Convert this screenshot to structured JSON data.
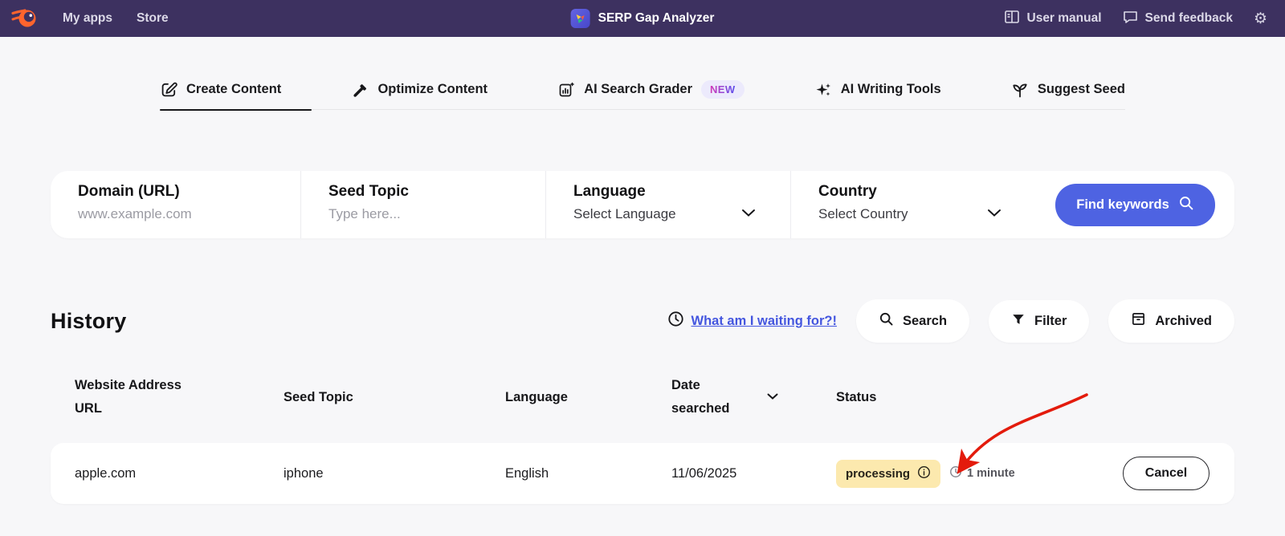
{
  "nav": {
    "logo_icon": "semrush-flame-icon",
    "items": [
      {
        "label": "My apps"
      },
      {
        "label": "Store"
      }
    ],
    "app_icon": "serp-gap-analyzer-app-icon",
    "app_title": "SERP Gap Analyzer",
    "links": [
      {
        "label": "User manual",
        "icon": "book-icon"
      },
      {
        "label": "Send feedback",
        "icon": "chat-bubble-icon"
      }
    ],
    "settings_icon_glyph": "⚙"
  },
  "tabs": [
    {
      "label": "Create Content",
      "icon": "edit-icon",
      "active": true
    },
    {
      "label": "Optimize Content",
      "icon": "hammer-icon",
      "active": false
    },
    {
      "label": "AI Search Grader",
      "icon": "grader-chart-icon",
      "active": false,
      "badge": "NEW"
    },
    {
      "label": "AI Writing Tools",
      "icon": "sparkles-icon",
      "active": false
    },
    {
      "label": "Suggest Seed",
      "icon": "seedling-icon",
      "active": false
    }
  ],
  "form": {
    "fields": [
      {
        "label": "Domain (URL)",
        "placeholder": "www.example.com",
        "type": "input"
      },
      {
        "label": "Seed Topic",
        "placeholder": "Type here...",
        "type": "input"
      },
      {
        "label": "Language",
        "value": "Select Language",
        "type": "select",
        "icon": "chevron-down-icon"
      },
      {
        "label": "Country",
        "value": "Select Country",
        "type": "select",
        "icon": "chevron-down-icon"
      }
    ],
    "submit_label": "Find keywords",
    "submit_icon": "search-icon"
  },
  "history": {
    "title": "History",
    "waiting_icon": "clock-icon",
    "waiting_link": "What am I waiting for?!",
    "actions": [
      {
        "label": "Search",
        "icon": "search-icon"
      },
      {
        "label": "Filter",
        "icon": "funnel-icon"
      },
      {
        "label": "Archived",
        "icon": "archive-box-icon"
      }
    ],
    "table": {
      "columns": [
        {
          "label": "Website Address URL"
        },
        {
          "label": "Seed Topic"
        },
        {
          "label": "Language"
        },
        {
          "label": "Date searched",
          "sort_icon": "chevron-down-icon"
        },
        {
          "label": "Status"
        }
      ],
      "rows": [
        {
          "website": "apple.com",
          "seed_topic": "iphone",
          "language": "English",
          "date": "11/06/2025",
          "status": "processing",
          "status_info_icon": "info-circle-icon",
          "duration_icon": "clock-icon",
          "duration": "1 minute",
          "action": "Cancel"
        }
      ]
    }
  },
  "annotations": {
    "red_arrow": "points-to-processing-duration"
  },
  "colors": {
    "navbar_bg": "#3d3160",
    "accent_orange": "#ff642d",
    "page_bg": "#f7f7f9",
    "primary_button": "#4e63e2",
    "link_blue": "#4456df",
    "status_badge_bg": "#fce9ae",
    "new_badge_bg": "#eceafc",
    "new_badge_gradient": [
      "#d23ab8",
      "#5a50ee"
    ],
    "arrow_red": "#e31b0c"
  }
}
